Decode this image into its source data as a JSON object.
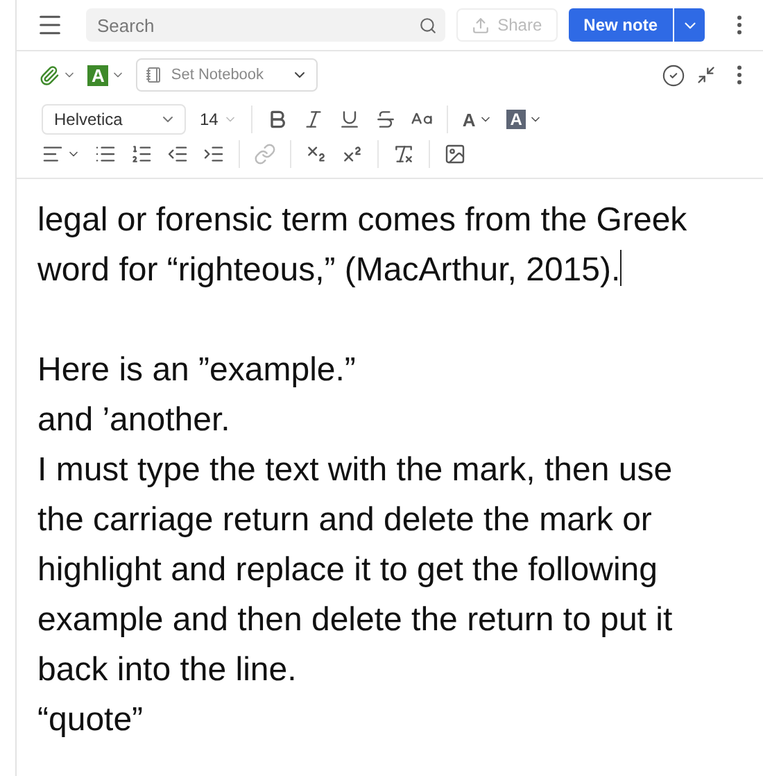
{
  "header": {
    "search": {
      "placeholder": "Search"
    },
    "share_button": "Share",
    "new_note_button": "New note"
  },
  "note_bar": {
    "tag_glyph": "A",
    "notebook": "Set Notebook"
  },
  "format_toolbar": {
    "font": "Helvetica",
    "size": "14",
    "text_color_glyph": "A",
    "highlight_glyph": "A"
  },
  "body": [
    {
      "kind": "text",
      "text": "legal or forensic term comes from the Greek word for “righteous,” (MacArthur, 2015).",
      "caret": true
    },
    {
      "kind": "blank"
    },
    {
      "kind": "text",
      "text": "Here is an ”example.”",
      "caret": false
    },
    {
      "kind": "text",
      "text": "and ’another.",
      "caret": false
    },
    {
      "kind": "text",
      "text": "I must type the text with the mark, then use the carriage return and delete the mark or highlight and replace it to get the following example and then delete the return to put it back into the line.",
      "caret": false
    },
    {
      "kind": "text",
      "text": "“quote”",
      "caret": false
    }
  ]
}
